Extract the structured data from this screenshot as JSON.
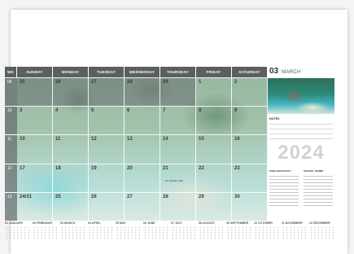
{
  "weekdays": [
    "SUNDAY",
    "MONDAY",
    "TUESDAY",
    "WEDNESDAY",
    "THURSDAY",
    "FRIDAY",
    "SATURDAY"
  ],
  "week_col_label": "WK",
  "weeks": [
    {
      "wk": "09",
      "days": [
        "25",
        "26",
        "27",
        "28",
        "29",
        "1",
        "2"
      ]
    },
    {
      "wk": "10",
      "days": [
        "3",
        "4",
        "5",
        "6",
        "7",
        "8",
        "9"
      ]
    },
    {
      "wk": "11",
      "days": [
        "10",
        "11",
        "12",
        "13",
        "14",
        "15",
        "16"
      ]
    },
    {
      "wk": "12",
      "days": [
        "17",
        "18",
        "19",
        "20",
        "21",
        "22",
        "23"
      ]
    },
    {
      "wk": "13",
      "days": [
        "24/31",
        "25",
        "26",
        "27",
        "28",
        "29",
        "30"
      ]
    }
  ],
  "month": {
    "number": "03",
    "name": "MARCH"
  },
  "notes_label": "NOTES",
  "year": "2024",
  "info_left_label": "PUBLICHOLIDAYS",
  "info_right_label": "SCHOOL TERMS",
  "cell_note": "St. Patrick's Day",
  "mini_months": [
    "01 JANUARY",
    "02 FEBRUARY",
    "03 MARCH",
    "04 APRIL",
    "05 MAY",
    "06 JUNE",
    "07 JULY",
    "08 AUGUST",
    "09 SEPTEMBER",
    "10 OCTOBER",
    "11 NOVEMBER",
    "12 DECEMBER"
  ],
  "accent": "#5b5f60"
}
